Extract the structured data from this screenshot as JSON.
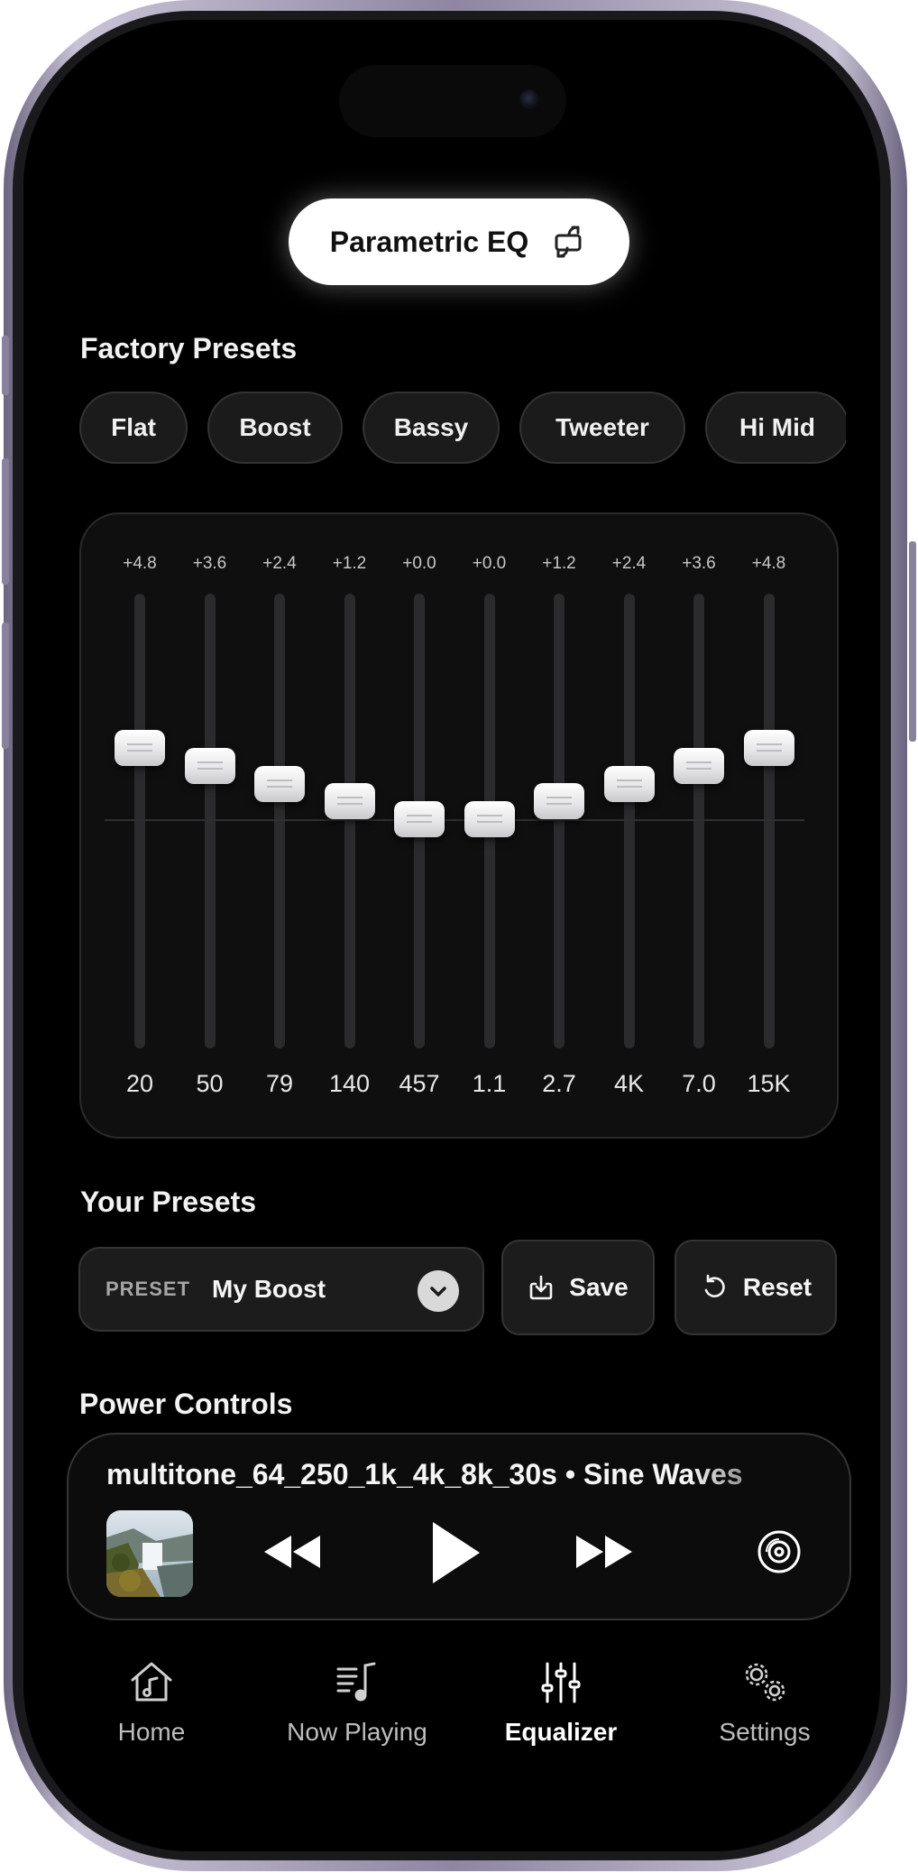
{
  "header": {
    "title": "Parametric EQ"
  },
  "factory_presets": {
    "title": "Factory Presets",
    "items": [
      {
        "label": "Flat"
      },
      {
        "label": "Boost"
      },
      {
        "label": "Bassy"
      },
      {
        "label": "Tweeter"
      },
      {
        "label": "Hi Mid"
      }
    ]
  },
  "equalizer": {
    "bands": [
      {
        "gain_label": "+4.8",
        "freq_label": "20",
        "gain": 4.8
      },
      {
        "gain_label": "+3.6",
        "freq_label": "50",
        "gain": 3.6
      },
      {
        "gain_label": "+2.4",
        "freq_label": "79",
        "gain": 2.4
      },
      {
        "gain_label": "+1.2",
        "freq_label": "140",
        "gain": 1.2
      },
      {
        "gain_label": "+0.0",
        "freq_label": "457",
        "gain": 0.0
      },
      {
        "gain_label": "+0.0",
        "freq_label": "1.1",
        "gain": 0.0
      },
      {
        "gain_label": "+1.2",
        "freq_label": "2.7",
        "gain": 1.2
      },
      {
        "gain_label": "+2.4",
        "freq_label": "4K",
        "gain": 2.4
      },
      {
        "gain_label": "+3.6",
        "freq_label": "7.0",
        "gain": 3.6
      },
      {
        "gain_label": "+4.8",
        "freq_label": "15K",
        "gain": 4.8
      }
    ]
  },
  "your_presets": {
    "title": "Your Presets",
    "select_label": "PRESET",
    "selected": "My Boost",
    "save_label": "Save",
    "reset_label": "Reset"
  },
  "power_controls": {
    "title": "Power Controls",
    "track_title": "multitone_64_250_1k_4k_8k_30s • Sine Waves"
  },
  "tabs": [
    {
      "label": "Home"
    },
    {
      "label": "Now Playing"
    },
    {
      "label": "Equalizer",
      "active": true
    },
    {
      "label": "Settings"
    }
  ],
  "colors": {
    "background": "#000000",
    "accent": "#ffffff",
    "panel": "#0f0f10",
    "chip": "#1b1b1c",
    "frame": "#8e86a2"
  },
  "icons": {
    "header": "swap-icon",
    "save": "download-icon",
    "reset": "reset-icon",
    "select": "chevron-down-icon",
    "player_prev": "rewind-icon",
    "player_play": "play-icon",
    "player_next": "fast-forward-icon",
    "player_disc": "disc-icon",
    "tabs": [
      "home-music-icon",
      "music-list-icon",
      "sliders-icon",
      "gears-icon"
    ]
  }
}
